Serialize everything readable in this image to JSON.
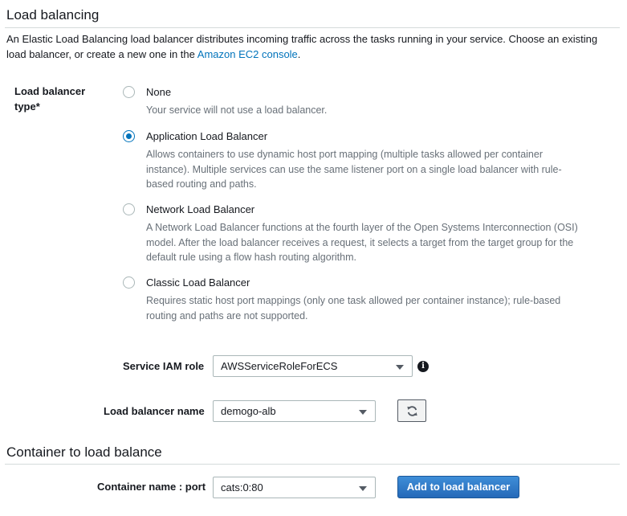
{
  "load_balancing": {
    "title": "Load balancing",
    "description_prefix": "An Elastic Load Balancing load balancer distributes incoming traffic across the tasks running in your service. Choose an existing load balancer, or create a new one in the ",
    "console_link": "Amazon EC2 console",
    "description_suffix": ".",
    "type_label": "Load balancer type*",
    "options": [
      {
        "label": "None",
        "description": "Your service will not use a load balancer.",
        "selected": false
      },
      {
        "label": "Application Load Balancer",
        "description": "Allows containers to use dynamic host port mapping (multiple tasks allowed per container instance). Multiple services can use the same listener port on a single load balancer with rule-based routing and paths.",
        "selected": true
      },
      {
        "label": "Network Load Balancer",
        "description": "A Network Load Balancer functions at the fourth layer of the Open Systems Interconnection (OSI) model. After the load balancer receives a request, it selects a target from the target group for the default rule using a flow hash routing algorithm.",
        "selected": false
      },
      {
        "label": "Classic Load Balancer",
        "description": "Requires static host port mappings (only one task allowed per container instance); rule-based routing and paths are not supported.",
        "selected": false
      }
    ],
    "iam_role": {
      "label": "Service IAM role",
      "value": "AWSServiceRoleForECS",
      "info_icon": "info-icon"
    },
    "lb_name": {
      "label": "Load balancer name",
      "value": "demogo-alb",
      "refresh_icon": "refresh-icon"
    }
  },
  "container_lb": {
    "title": "Container to load balance",
    "container": {
      "label": "Container name : port",
      "value": "cats:0:80"
    },
    "add_button": "Add to load balancer"
  },
  "colors": {
    "link": "#0073bb",
    "radio_selected": "#0073bb",
    "primary_button": "#2e73c4"
  }
}
